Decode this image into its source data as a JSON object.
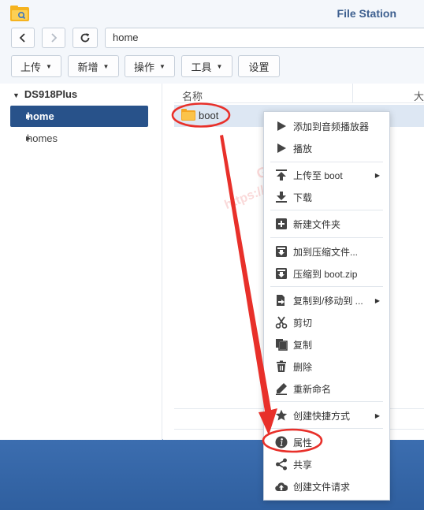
{
  "window": {
    "title": "File Station"
  },
  "nav": {
    "path": "home"
  },
  "toolbar": {
    "upload": "上传",
    "create": "新增",
    "action": "操作",
    "tools": "工具",
    "settings": "设置"
  },
  "sidebar": {
    "root": "DS918Plus",
    "items": [
      {
        "label": "home",
        "selected": true
      },
      {
        "label": "homes",
        "selected": false
      }
    ]
  },
  "filelist": {
    "columns": [
      "名称",
      "大"
    ],
    "rows": [
      {
        "name": "boot",
        "type": "folder"
      }
    ]
  },
  "context_menu": {
    "items": [
      {
        "label": "添加到音频播放器",
        "icon": "play-icon"
      },
      {
        "label": "播放",
        "icon": "play-icon"
      },
      {
        "label": "上传至 boot",
        "icon": "upload-icon",
        "submenu": true
      },
      {
        "label": "下载",
        "icon": "download-icon"
      },
      {
        "label": "新建文件夹",
        "icon": "new-folder-icon"
      },
      {
        "label": "加到压缩文件...",
        "icon": "archive-icon"
      },
      {
        "label": "压缩到 boot.zip",
        "icon": "archive-icon"
      },
      {
        "label": "复制到/移动到 ...",
        "icon": "copy-move-icon",
        "submenu": true
      },
      {
        "label": "剪切",
        "icon": "scissors-icon"
      },
      {
        "label": "复制",
        "icon": "copy-icon"
      },
      {
        "label": "删除",
        "icon": "trash-icon"
      },
      {
        "label": "重新命名",
        "icon": "pencil-icon"
      },
      {
        "label": "创建快捷方式",
        "icon": "star-icon",
        "submenu": true
      },
      {
        "label": "属性",
        "icon": "info-icon"
      },
      {
        "label": "共享",
        "icon": "share-icon"
      },
      {
        "label": "创建文件请求",
        "icon": "cloud-upload-icon"
      }
    ]
  },
  "watermark": {
    "line1": "GXNAS 博客",
    "line2": "https://wp.gxnas.com"
  },
  "colors": {
    "accent": "#28528a",
    "annotation": "#e8302a",
    "selected_row": "#dde7f3"
  }
}
